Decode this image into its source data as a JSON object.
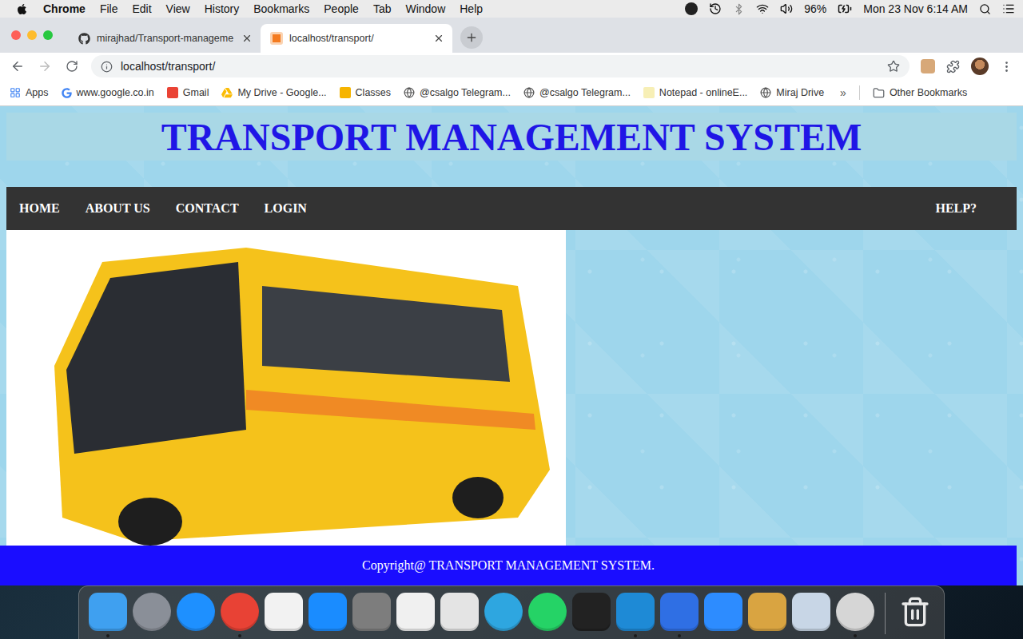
{
  "menubar": {
    "app": "Chrome",
    "items": [
      "File",
      "Edit",
      "View",
      "History",
      "Bookmarks",
      "People",
      "Tab",
      "Window",
      "Help"
    ],
    "battery": "96%",
    "clock": "Mon 23 Nov 6:14 AM"
  },
  "tabs": [
    {
      "label": "mirajhad/Transport-manageme",
      "selected": false,
      "kind": "github"
    },
    {
      "label": "localhost/transport/",
      "selected": true,
      "kind": "xampp"
    }
  ],
  "address": "localhost/transport/",
  "bookmarks": {
    "items": [
      {
        "label": "Apps",
        "kind": "apps"
      },
      {
        "label": "www.google.co.in",
        "kind": "google"
      },
      {
        "label": "Gmail",
        "kind": "gmail"
      },
      {
        "label": "My Drive - Google...",
        "kind": "drive"
      },
      {
        "label": "Classes",
        "kind": "classroom"
      },
      {
        "label": "@csalgo Telegram...",
        "kind": "globe"
      },
      {
        "label": "@csalgo Telegram...",
        "kind": "globe"
      },
      {
        "label": "Notepad - onlineE...",
        "kind": "notepad"
      },
      {
        "label": "Miraj Drive",
        "kind": "globe"
      }
    ],
    "overflow": "»",
    "other": "Other Bookmarks"
  },
  "page": {
    "title": "TRANSPORT MANAGEMENT SYSTEM",
    "nav": [
      {
        "label": "HOME",
        "side": "left"
      },
      {
        "label": "ABOUT US",
        "side": "left"
      },
      {
        "label": "CONTACT",
        "side": "left"
      },
      {
        "label": "LOGIN",
        "side": "left"
      },
      {
        "label": "HELP?",
        "side": "right"
      }
    ],
    "footer": "Copyright@ TRANSPORT MANAGEMENT SYSTEM."
  },
  "dock": [
    {
      "kind": "square",
      "color": "#3fa0f0",
      "running": true
    },
    {
      "kind": "circle",
      "color": "#8a8f98",
      "running": false
    },
    {
      "kind": "circle",
      "color": "#1e90ff",
      "running": false
    },
    {
      "kind": "circle",
      "color": "#e84235",
      "running": true
    },
    {
      "kind": "square",
      "color": "#f2f2f2",
      "running": false
    },
    {
      "kind": "square",
      "color": "#1a8cff",
      "running": false
    },
    {
      "kind": "square",
      "color": "#7d7d7d",
      "running": false
    },
    {
      "kind": "square",
      "color": "#f0f0f0",
      "running": false
    },
    {
      "kind": "square",
      "color": "#e4e4e4",
      "running": false
    },
    {
      "kind": "circle",
      "color": "#2ea6e0",
      "running": false
    },
    {
      "kind": "circle",
      "color": "#25d366",
      "running": false
    },
    {
      "kind": "square",
      "color": "#222222",
      "running": false
    },
    {
      "kind": "square",
      "color": "#1e8ad6",
      "running": true
    },
    {
      "kind": "square",
      "color": "#2f6fe4",
      "running": true
    },
    {
      "kind": "square",
      "color": "#2d8cff",
      "running": false
    },
    {
      "kind": "square",
      "color": "#d9a441",
      "running": false
    },
    {
      "kind": "square",
      "color": "#c8d6e6",
      "running": false
    },
    {
      "kind": "circle",
      "color": "#d6d6d6",
      "running": true
    }
  ]
}
